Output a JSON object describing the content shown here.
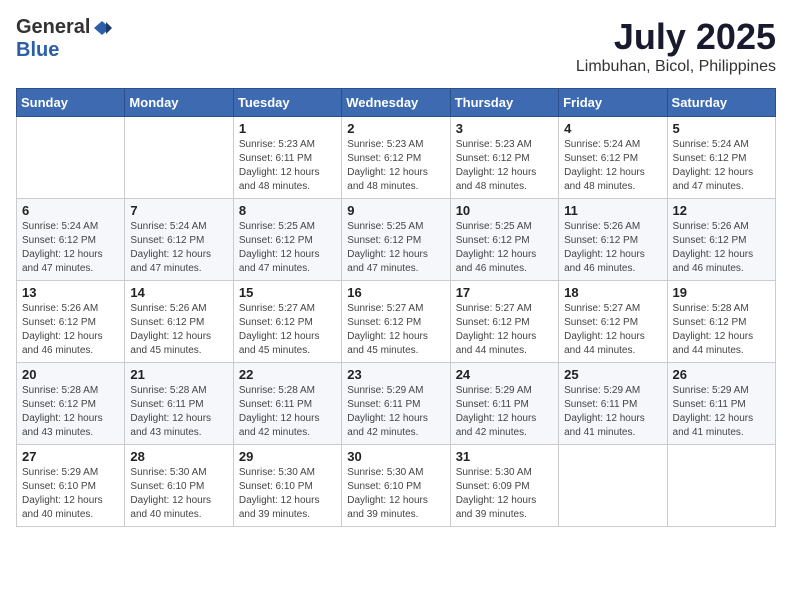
{
  "header": {
    "logo_general": "General",
    "logo_blue": "Blue",
    "month_year": "July 2025",
    "location": "Limbuhan, Bicol, Philippines"
  },
  "weekdays": [
    "Sunday",
    "Monday",
    "Tuesday",
    "Wednesday",
    "Thursday",
    "Friday",
    "Saturday"
  ],
  "weeks": [
    [
      {
        "day": "",
        "sunrise": "",
        "sunset": "",
        "daylight": ""
      },
      {
        "day": "",
        "sunrise": "",
        "sunset": "",
        "daylight": ""
      },
      {
        "day": "1",
        "sunrise": "Sunrise: 5:23 AM",
        "sunset": "Sunset: 6:11 PM",
        "daylight": "Daylight: 12 hours and 48 minutes."
      },
      {
        "day": "2",
        "sunrise": "Sunrise: 5:23 AM",
        "sunset": "Sunset: 6:12 PM",
        "daylight": "Daylight: 12 hours and 48 minutes."
      },
      {
        "day": "3",
        "sunrise": "Sunrise: 5:23 AM",
        "sunset": "Sunset: 6:12 PM",
        "daylight": "Daylight: 12 hours and 48 minutes."
      },
      {
        "day": "4",
        "sunrise": "Sunrise: 5:24 AM",
        "sunset": "Sunset: 6:12 PM",
        "daylight": "Daylight: 12 hours and 48 minutes."
      },
      {
        "day": "5",
        "sunrise": "Sunrise: 5:24 AM",
        "sunset": "Sunset: 6:12 PM",
        "daylight": "Daylight: 12 hours and 47 minutes."
      }
    ],
    [
      {
        "day": "6",
        "sunrise": "Sunrise: 5:24 AM",
        "sunset": "Sunset: 6:12 PM",
        "daylight": "Daylight: 12 hours and 47 minutes."
      },
      {
        "day": "7",
        "sunrise": "Sunrise: 5:24 AM",
        "sunset": "Sunset: 6:12 PM",
        "daylight": "Daylight: 12 hours and 47 minutes."
      },
      {
        "day": "8",
        "sunrise": "Sunrise: 5:25 AM",
        "sunset": "Sunset: 6:12 PM",
        "daylight": "Daylight: 12 hours and 47 minutes."
      },
      {
        "day": "9",
        "sunrise": "Sunrise: 5:25 AM",
        "sunset": "Sunset: 6:12 PM",
        "daylight": "Daylight: 12 hours and 47 minutes."
      },
      {
        "day": "10",
        "sunrise": "Sunrise: 5:25 AM",
        "sunset": "Sunset: 6:12 PM",
        "daylight": "Daylight: 12 hours and 46 minutes."
      },
      {
        "day": "11",
        "sunrise": "Sunrise: 5:26 AM",
        "sunset": "Sunset: 6:12 PM",
        "daylight": "Daylight: 12 hours and 46 minutes."
      },
      {
        "day": "12",
        "sunrise": "Sunrise: 5:26 AM",
        "sunset": "Sunset: 6:12 PM",
        "daylight": "Daylight: 12 hours and 46 minutes."
      }
    ],
    [
      {
        "day": "13",
        "sunrise": "Sunrise: 5:26 AM",
        "sunset": "Sunset: 6:12 PM",
        "daylight": "Daylight: 12 hours and 46 minutes."
      },
      {
        "day": "14",
        "sunrise": "Sunrise: 5:26 AM",
        "sunset": "Sunset: 6:12 PM",
        "daylight": "Daylight: 12 hours and 45 minutes."
      },
      {
        "day": "15",
        "sunrise": "Sunrise: 5:27 AM",
        "sunset": "Sunset: 6:12 PM",
        "daylight": "Daylight: 12 hours and 45 minutes."
      },
      {
        "day": "16",
        "sunrise": "Sunrise: 5:27 AM",
        "sunset": "Sunset: 6:12 PM",
        "daylight": "Daylight: 12 hours and 45 minutes."
      },
      {
        "day": "17",
        "sunrise": "Sunrise: 5:27 AM",
        "sunset": "Sunset: 6:12 PM",
        "daylight": "Daylight: 12 hours and 44 minutes."
      },
      {
        "day": "18",
        "sunrise": "Sunrise: 5:27 AM",
        "sunset": "Sunset: 6:12 PM",
        "daylight": "Daylight: 12 hours and 44 minutes."
      },
      {
        "day": "19",
        "sunrise": "Sunrise: 5:28 AM",
        "sunset": "Sunset: 6:12 PM",
        "daylight": "Daylight: 12 hours and 44 minutes."
      }
    ],
    [
      {
        "day": "20",
        "sunrise": "Sunrise: 5:28 AM",
        "sunset": "Sunset: 6:12 PM",
        "daylight": "Daylight: 12 hours and 43 minutes."
      },
      {
        "day": "21",
        "sunrise": "Sunrise: 5:28 AM",
        "sunset": "Sunset: 6:11 PM",
        "daylight": "Daylight: 12 hours and 43 minutes."
      },
      {
        "day": "22",
        "sunrise": "Sunrise: 5:28 AM",
        "sunset": "Sunset: 6:11 PM",
        "daylight": "Daylight: 12 hours and 42 minutes."
      },
      {
        "day": "23",
        "sunrise": "Sunrise: 5:29 AM",
        "sunset": "Sunset: 6:11 PM",
        "daylight": "Daylight: 12 hours and 42 minutes."
      },
      {
        "day": "24",
        "sunrise": "Sunrise: 5:29 AM",
        "sunset": "Sunset: 6:11 PM",
        "daylight": "Daylight: 12 hours and 42 minutes."
      },
      {
        "day": "25",
        "sunrise": "Sunrise: 5:29 AM",
        "sunset": "Sunset: 6:11 PM",
        "daylight": "Daylight: 12 hours and 41 minutes."
      },
      {
        "day": "26",
        "sunrise": "Sunrise: 5:29 AM",
        "sunset": "Sunset: 6:11 PM",
        "daylight": "Daylight: 12 hours and 41 minutes."
      }
    ],
    [
      {
        "day": "27",
        "sunrise": "Sunrise: 5:29 AM",
        "sunset": "Sunset: 6:10 PM",
        "daylight": "Daylight: 12 hours and 40 minutes."
      },
      {
        "day": "28",
        "sunrise": "Sunrise: 5:30 AM",
        "sunset": "Sunset: 6:10 PM",
        "daylight": "Daylight: 12 hours and 40 minutes."
      },
      {
        "day": "29",
        "sunrise": "Sunrise: 5:30 AM",
        "sunset": "Sunset: 6:10 PM",
        "daylight": "Daylight: 12 hours and 39 minutes."
      },
      {
        "day": "30",
        "sunrise": "Sunrise: 5:30 AM",
        "sunset": "Sunset: 6:10 PM",
        "daylight": "Daylight: 12 hours and 39 minutes."
      },
      {
        "day": "31",
        "sunrise": "Sunrise: 5:30 AM",
        "sunset": "Sunset: 6:09 PM",
        "daylight": "Daylight: 12 hours and 39 minutes."
      },
      {
        "day": "",
        "sunrise": "",
        "sunset": "",
        "daylight": ""
      },
      {
        "day": "",
        "sunrise": "",
        "sunset": "",
        "daylight": ""
      }
    ]
  ]
}
